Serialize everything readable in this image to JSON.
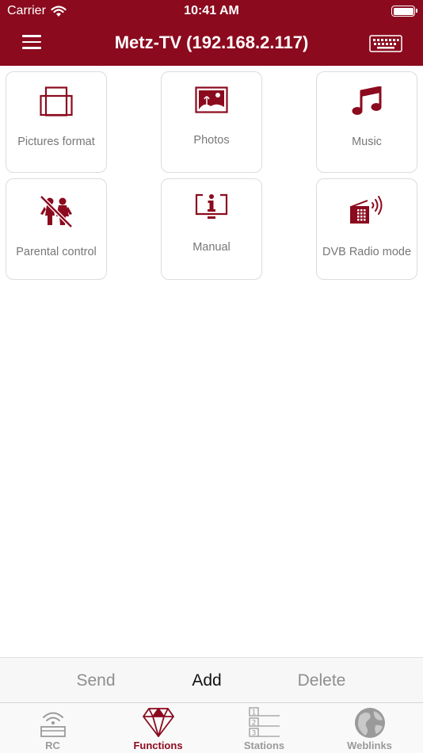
{
  "status": {
    "carrier": "Carrier",
    "time": "10:41 AM"
  },
  "header": {
    "title": "Metz-TV (192.168.2.117)"
  },
  "tiles": [
    {
      "label": "Pictures format",
      "icon": "picture-format-icon"
    },
    {
      "label": "Photos",
      "icon": "photos-icon"
    },
    {
      "label": "Music",
      "icon": "music-note-icon"
    },
    {
      "label": "Parental control",
      "icon": "parental-control-icon"
    },
    {
      "label": "Manual",
      "icon": "manual-info-icon"
    },
    {
      "label": "DVB Radio mode",
      "icon": "dvb-radio-icon"
    }
  ],
  "actions": {
    "send": "Send",
    "add": "Add",
    "delete": "Delete"
  },
  "tabs": [
    {
      "label": "RC",
      "icon": "remote-control-icon"
    },
    {
      "label": "Functions",
      "icon": "diamond-icon",
      "active": true
    },
    {
      "label": "Stations",
      "icon": "stations-list-icon"
    },
    {
      "label": "Weblinks",
      "icon": "globe-icon"
    }
  ],
  "colors": {
    "brand": "#8b0a1e",
    "inactive": "#9a9a9a",
    "tile_border": "#dcdcdc"
  }
}
